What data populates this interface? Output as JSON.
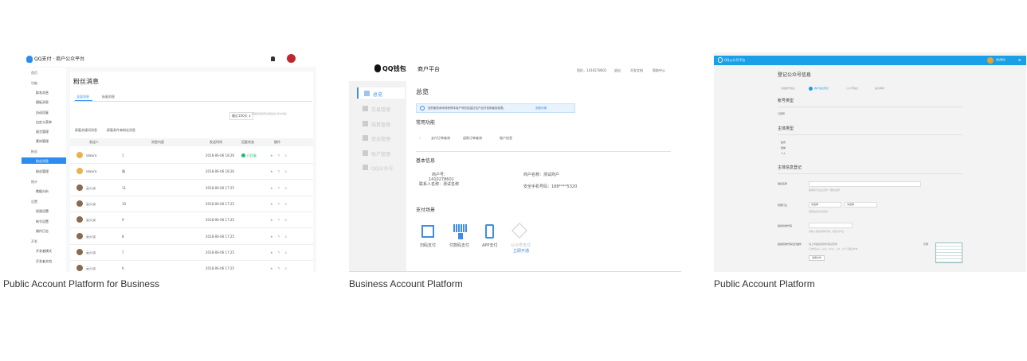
{
  "cards": [
    {
      "caption": "Public Account Platform for Business",
      "brand": "QQ支付 · 商户公众平台",
      "sidebar": [
        "首页",
        "功能",
        "群发消息",
        "模板消息",
        "自动回复",
        "自定义菜单",
        "留言管理",
        "素材管理",
        "粉丝",
        "粉丝消息",
        "粉丝管理",
        "统计",
        "数据分析",
        "设置",
        "权限设置",
        "帐号设置",
        "操作日志",
        "开发",
        "开发者模式",
        "开发者文档"
      ],
      "page_title": "粉丝消息",
      "tabs": [
        "全部消息",
        "标星消息"
      ],
      "filter_select": "最近100天 ⇕",
      "filter_hint": "若能搜索搜索内容最近5天内消息",
      "checks": [
        "屏蔽关键词消息",
        "屏蔽条件来粉丝消息"
      ],
      "table_headers": [
        "发送人",
        "消息内容",
        "发送时间",
        "回复状态",
        "操作"
      ],
      "rows": [
        {
          "name": "sakura",
          "count": "1",
          "time": "2018-06-06 18:26",
          "status": "已回复"
        },
        {
          "name": "sakura",
          "count": "隋",
          "time": "2018-06-06 18:26",
          "status": ""
        },
        {
          "name": "云火淡",
          "count": "11",
          "time": "2018-06-06 17:25",
          "status": ""
        },
        {
          "name": "云火淡",
          "count": "10",
          "time": "2018-06-06 17:25",
          "status": ""
        },
        {
          "name": "云火淡",
          "count": "9",
          "time": "2018-06-06 17:25",
          "status": ""
        },
        {
          "name": "云火淡",
          "count": "8",
          "time": "2018-06-06 17:25",
          "status": ""
        },
        {
          "name": "云火淡",
          "count": "7",
          "time": "2018-06-06 17:25",
          "status": ""
        },
        {
          "name": "云火淡",
          "count": "6",
          "time": "2018-06-06 17:25",
          "status": ""
        }
      ]
    },
    {
      "caption": "Business Account Platform",
      "brand": "QQ钱包",
      "brand_sub": "商户平台",
      "top_links": [
        "您好，1410278601",
        "退出",
        "开发文档",
        "帮助中心"
      ],
      "sidebar": [
        "总览",
        "交易管理",
        "结算管理",
        "资金管理",
        "账户管理",
        "QQ公众号"
      ],
      "title": "总览",
      "notice": "您的服务商申请获得本商户号的现金红包产品开发和使用权限。",
      "notice_link": "查看详情",
      "common_title": "常用功能",
      "common_items": [
        "支付订单查询",
        "退款订单查询",
        "账户信息"
      ],
      "basic_title": "基本信息",
      "merchant_id_label": "商户号:",
      "merchant_id": "1410278601",
      "merchant_name": "商户名称：测试商户",
      "contact": "联系人名称：测试名称",
      "phone": "安全手机号码：188****5320",
      "pay_title": "支付场景",
      "pay_items": [
        "扫码支付",
        "付款码支付",
        "APP支付",
        "公众号支付"
      ],
      "pay_link": "立即开通"
    },
    {
      "caption": "Public Account Platform",
      "brand": "QQ公众号平台",
      "user": "测试联系",
      "title": "登记公众号信息",
      "steps": [
        "基础帐号信息",
        "用户信息登记",
        "公众号信息",
        "提交审核"
      ],
      "sections": [
        "帐号类型",
        "主体类型",
        "主体信息登记"
      ],
      "account_type": "订阅号",
      "radios": [
        "政府",
        "媒体",
        "个人"
      ],
      "fields": [
        "组织名称",
        "所属行业",
        "组织机构代码",
        "组织机构代码证扫描件"
      ],
      "field_hint1": "需填写与企业证件一致的全称",
      "select1": "请选择",
      "select2": "请选择",
      "hint2": "选择后将无法修改",
      "hint3": "请输入组织机构代码，格式为9位",
      "upload_hint": "请上传组织机构代码证原件",
      "upload_format": "只支持jpg、png、bmp、gif，大小不超过5M",
      "upload_btn": "选择文件",
      "example_label": "示例"
    }
  ]
}
